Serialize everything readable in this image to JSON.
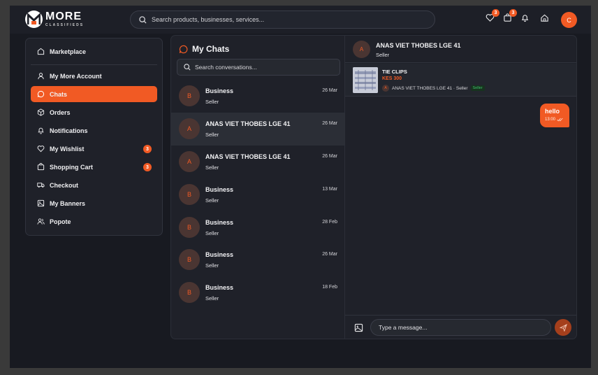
{
  "brand": {
    "title": "MORE",
    "subtitle": "CLASSIFIEDS"
  },
  "search": {
    "placeholder": "Search products, businesses, services..."
  },
  "header": {
    "wishlist_count": "3",
    "cart_count": "3",
    "avatar_initial": "C",
    "icons": [
      "heart-icon",
      "cart-icon",
      "bell-icon",
      "home-icon"
    ]
  },
  "sidebar": {
    "items": [
      {
        "label": "Marketplace",
        "icon": "store-icon"
      },
      {
        "label": "My More Account",
        "icon": "user-icon"
      },
      {
        "label": "Chats",
        "icon": "chat-icon",
        "active": true
      },
      {
        "label": "Orders",
        "icon": "box-icon"
      },
      {
        "label": "Notifications",
        "icon": "bell-icon"
      },
      {
        "label": "My Wishlist",
        "icon": "heart-icon",
        "badge": "3"
      },
      {
        "label": "Shopping Cart",
        "icon": "cart-icon",
        "badge": "3"
      },
      {
        "label": "Checkout",
        "icon": "truck-icon"
      },
      {
        "label": "My Banners",
        "icon": "image-icon"
      },
      {
        "label": "Popote",
        "icon": "users-icon"
      }
    ]
  },
  "chats": {
    "title": "My Chats",
    "search_placeholder": "Search conversations...",
    "list": [
      {
        "initial": "B",
        "name": "Business",
        "role": "Seller",
        "date": "26 Mar"
      },
      {
        "initial": "A",
        "name": "ANAS VIET THOBES LGE 41",
        "role": "Seller",
        "date": "26 Mar",
        "selected": true
      },
      {
        "initial": "A",
        "name": "ANAS VIET THOBES LGE 41",
        "role": "Seller",
        "date": "26 Mar"
      },
      {
        "initial": "B",
        "name": "Business",
        "role": "Seller",
        "date": "13 Mar"
      },
      {
        "initial": "B",
        "name": "Business",
        "role": "Seller",
        "date": "28 Feb"
      },
      {
        "initial": "B",
        "name": "Business",
        "role": "Seller",
        "date": "26 Mar"
      },
      {
        "initial": "B",
        "name": "Business",
        "role": "Seller",
        "date": "18 Feb"
      }
    ]
  },
  "conversation": {
    "initial": "A",
    "name": "ANAS VIET THOBES LGE 41",
    "role": "Seller",
    "product": {
      "name": "TIE CLIPS",
      "price": "KES 300",
      "seller_initial": "A",
      "seller_line": "ANAS VIET THOBES LGE 41 · Seller",
      "tag": "Seller"
    },
    "messages": [
      {
        "text": "hello",
        "time": "13:00"
      }
    ],
    "input_placeholder": "Type a message..."
  },
  "colors": {
    "accent": "#f15a24",
    "background": "#181a21",
    "panel": "#1f2129"
  }
}
